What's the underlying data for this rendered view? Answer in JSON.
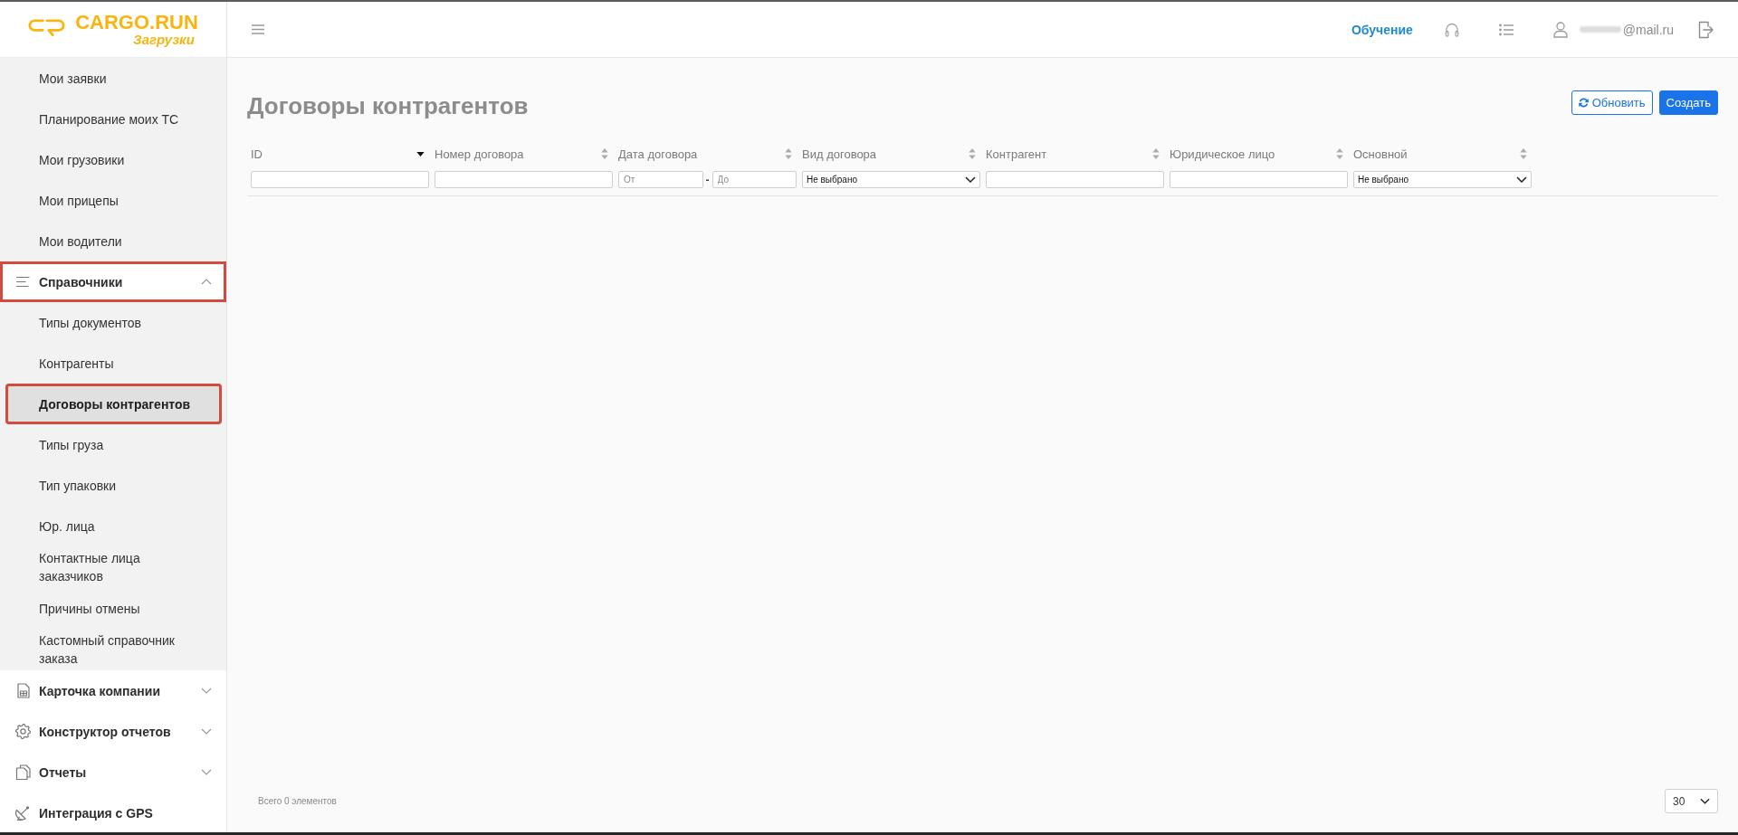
{
  "logo": {
    "name": "CARGO.RUN",
    "subtitle": "Загрузки"
  },
  "header": {
    "links": [
      {
        "label": "Обучение"
      }
    ],
    "user": {
      "email": "@mail.ru",
      "redacted": true
    }
  },
  "sidebar": {
    "items": [
      {
        "kind": "sub_link",
        "label": "Мои заявки",
        "selected": false,
        "highlighted": false
      },
      {
        "kind": "sub_link",
        "label": "Планирование моих ТС",
        "selected": false,
        "highlighted": false
      },
      {
        "kind": "sub_link",
        "label": "Мои грузовики",
        "selected": false,
        "highlighted": false
      },
      {
        "kind": "sub_link",
        "label": "Мои прицепы",
        "selected": false,
        "highlighted": false
      },
      {
        "kind": "sub_link",
        "label": "Мои водители",
        "selected": false,
        "highlighted": false
      },
      {
        "kind": "group",
        "label": "Справочники",
        "selected": false,
        "highlighted": true,
        "expanded": true,
        "children": [
          {
            "label": "Типы документов",
            "selected": false,
            "highlighted": false
          },
          {
            "label": "Контрагенты",
            "selected": false,
            "highlighted": false
          },
          {
            "label": "Договоры контрагентов",
            "selected": true,
            "highlighted": true
          },
          {
            "label": "Типы груза",
            "selected": false,
            "highlighted": false
          },
          {
            "label": "Тип упаковки",
            "selected": false,
            "highlighted": false
          },
          {
            "label": "Юр. лица",
            "selected": false,
            "highlighted": false
          },
          {
            "label": "Контактные лица заказчиков",
            "selected": false,
            "highlighted": false
          },
          {
            "label": "Причины отмены",
            "selected": false,
            "highlighted": false
          },
          {
            "label": "Кастомный справочник заказа",
            "selected": false,
            "highlighted": false
          }
        ]
      },
      {
        "kind": "group",
        "label": "Карточка компании",
        "selected": false,
        "highlighted": false,
        "expanded": false
      },
      {
        "kind": "group",
        "label": "Конструктор отчетов",
        "selected": false,
        "highlighted": false,
        "expanded": false
      },
      {
        "kind": "group",
        "label": "Отчеты",
        "selected": false,
        "highlighted": false,
        "expanded": false
      },
      {
        "kind": "link",
        "label": "Интеграция с GPS",
        "selected": false,
        "highlighted": false
      }
    ]
  },
  "page": {
    "title": "Договоры контрагентов",
    "buttons": [
      {
        "kind": "refresh",
        "label": "Обновить"
      },
      {
        "kind": "create",
        "label": "Создать"
      }
    ],
    "table": {
      "columns": [
        {
          "label": "ID",
          "sorted": true,
          "filter": {
            "kind": "text"
          }
        },
        {
          "label": "Номер договора",
          "sorted": false,
          "filter": {
            "kind": "text"
          }
        },
        {
          "label": "Дата договора",
          "sorted": false,
          "filter": {
            "kind": "date_range",
            "from": {
              "placeholder": "От"
            },
            "separator": "-",
            "to": {
              "placeholder": "До"
            }
          }
        },
        {
          "label": "Вид договора",
          "sorted": false,
          "filter": {
            "kind": "select",
            "value": "Не выбрано"
          }
        },
        {
          "label": "Контрагент",
          "sorted": false,
          "filter": {
            "kind": "text"
          }
        },
        {
          "label": "Юридическое лицо",
          "sorted": false,
          "filter": {
            "kind": "text"
          }
        },
        {
          "label": "Основной",
          "sorted": false,
          "filter": {
            "kind": "select",
            "value": "Не выбрано"
          }
        }
      ]
    },
    "footer": {
      "total": "Всего 0 элементов",
      "page_size": "30"
    }
  }
}
